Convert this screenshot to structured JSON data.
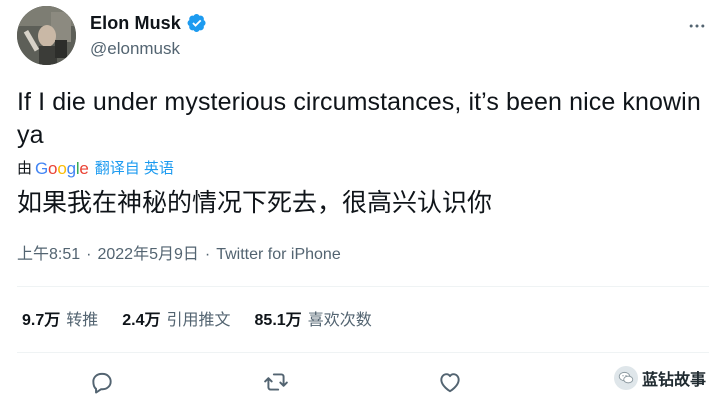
{
  "author": {
    "display_name": "Elon Musk",
    "handle": "@elonmusk",
    "verified": true,
    "avatar_icon": "profile-avatar"
  },
  "tweet": {
    "text": "If I die under mysterious circumstances, it’s been nice knowin ya",
    "translate": {
      "by_label": "由",
      "provider": [
        "G",
        "o",
        "o",
        "g",
        "l",
        "e"
      ],
      "provider_colors": [
        "#4285F4",
        "#EA4335",
        "#FBBC05",
        "#4285F4",
        "#34A853",
        "#EA4335"
      ],
      "link_label": "翻译自 英语"
    },
    "translation": "如果我在神秘的情况下死去，很高兴认识你"
  },
  "meta": {
    "time": "上午8:51",
    "separator_1": "·",
    "date": "2022年5月9日",
    "separator_2": "·",
    "source": "Twitter for iPhone"
  },
  "stats": {
    "retweets": {
      "value": "9.7万",
      "label": "转推"
    },
    "quotes": {
      "value": "2.4万",
      "label": "引用推文"
    },
    "likes": {
      "value": "85.1万",
      "label": "喜欢次数"
    }
  },
  "actions": {
    "reply_icon": "reply-icon",
    "retweet_icon": "retweet-icon",
    "like_icon": "heart-icon",
    "share_icon": "share-icon"
  },
  "watermark": {
    "text": "蓝钻故事"
  },
  "colors": {
    "text": "#0f1419",
    "secondary": "#536471",
    "accent": "#1d9bf0",
    "divider": "#eff3f4"
  }
}
